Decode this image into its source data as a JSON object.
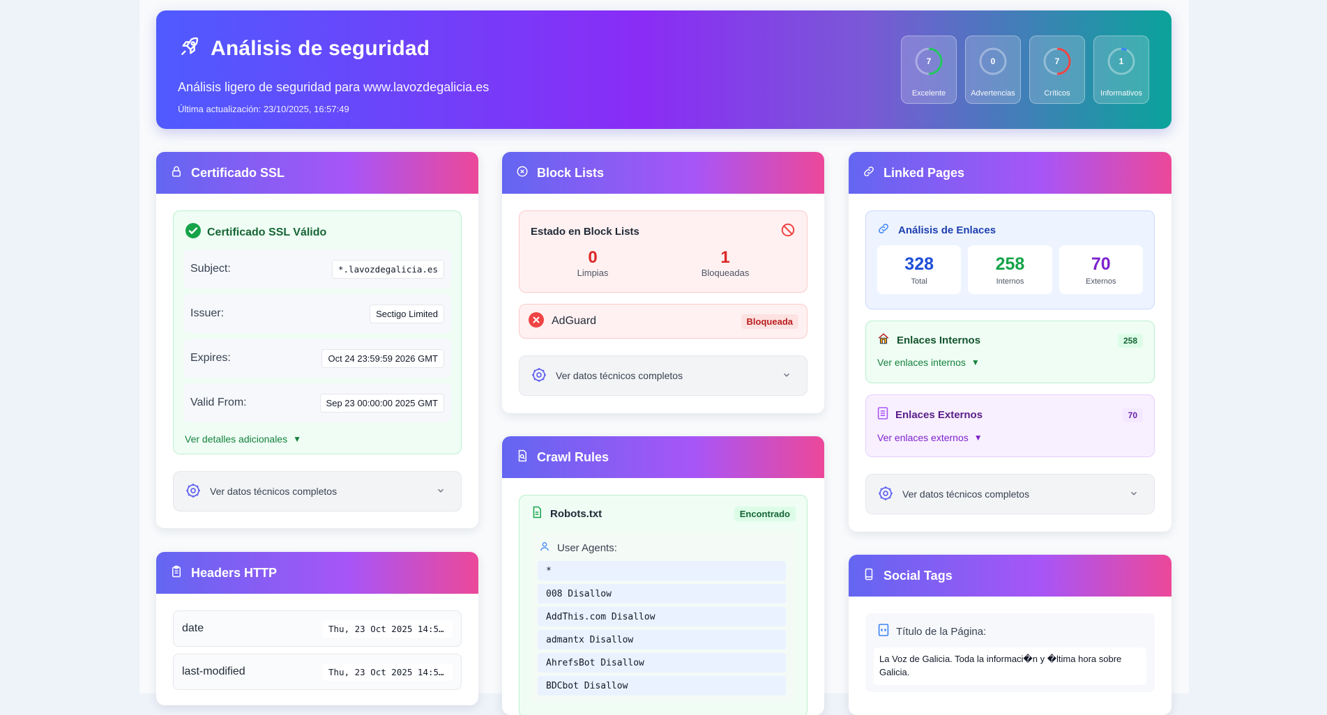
{
  "header": {
    "title": "Análisis de seguridad",
    "subtitle": "Análisis ligero de seguridad para www.lavozdegalicia.es",
    "updated": "Última actualización: 23/10/2025, 16:57:49",
    "stats": [
      {
        "value": "7",
        "label": "Excelente",
        "ring_fraction": 0.5,
        "color": "#22c55e"
      },
      {
        "value": "0",
        "label": "Advertencias",
        "ring_fraction": 0,
        "color": "#f59e0b"
      },
      {
        "value": "7",
        "label": "Críticos",
        "ring_fraction": 0.5,
        "color": "#ef4444"
      },
      {
        "value": "1",
        "label": "Informativos",
        "ring_fraction": 0.07,
        "color": "#3b82f6"
      }
    ]
  },
  "ssl": {
    "title": "Certificado SSL",
    "status": "Certificado SSL Válido",
    "rows": [
      {
        "key": "Subject:",
        "value": "*.lavozdegalicia.es"
      },
      {
        "key": "Issuer:",
        "value": "Sectigo Limited"
      },
      {
        "key": "Expires:",
        "value": "Oct 24 23:59:59 2026 GMT"
      },
      {
        "key": "Valid From:",
        "value": "Sep 23 00:00:00 2025 GMT"
      }
    ],
    "more": "Ver detalles adicionales",
    "tech": "Ver datos técnicos completos"
  },
  "headers": {
    "title": "Headers HTTP",
    "rows": [
      {
        "key": "date",
        "value": "Thu, 23 Oct 2025 14:5…"
      },
      {
        "key": "last-modified",
        "value": "Thu, 23 Oct 2025 14:5…"
      }
    ]
  },
  "blocklists": {
    "title": "Block Lists",
    "status_title": "Estado en Block Lists",
    "clean_count": "0",
    "clean_label": "Limpias",
    "blocked_count": "1",
    "blocked_label": "Bloqueadas",
    "entries": [
      {
        "name": "AdGuard",
        "status": "Bloqueada"
      }
    ],
    "tech": "Ver datos técnicos completos"
  },
  "crawl": {
    "title": "Crawl Rules",
    "file": "Robots.txt",
    "badge": "Encontrado",
    "agents_label": "User Agents:",
    "agents": [
      "*",
      "008 Disallow",
      "AddThis.com Disallow",
      "admantx Disallow",
      "AhrefsBot Disallow",
      "BDCbot Disallow"
    ]
  },
  "linked": {
    "title": "Linked Pages",
    "analysis_title": "Análisis de Enlaces",
    "total": "328",
    "total_label": "Total",
    "internal": "258",
    "internal_label": "Internos",
    "external": "70",
    "external_label": "Externos",
    "internal_title": "Enlaces Internos",
    "internal_badge": "258",
    "internal_link": "Ver enlaces internos",
    "external_title": "Enlaces Externos",
    "external_badge": "70",
    "external_link": "Ver enlaces externos",
    "tech": "Ver datos técnicos completos"
  },
  "social": {
    "title": "Social Tags",
    "page_title_label": "Título de la Página:",
    "page_title_value": "La Voz de Galicia. Toda la informaci�n y �ltima hora sobre Galicia."
  }
}
